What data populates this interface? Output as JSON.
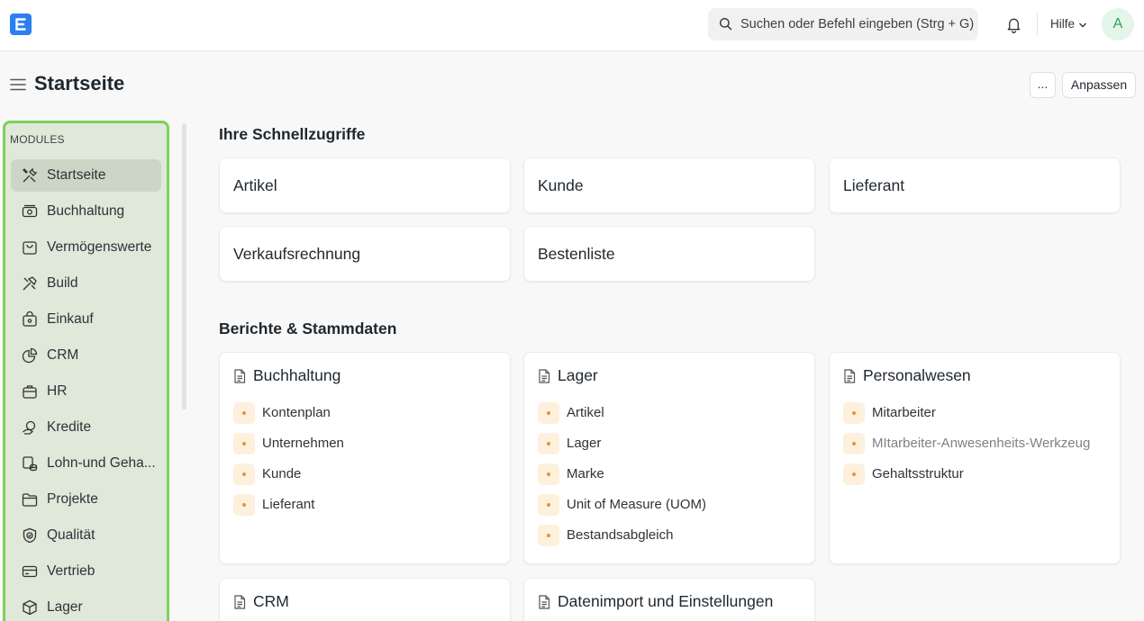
{
  "navbar": {
    "search_placeholder": "Suchen oder Befehl eingeben (Strg + G)",
    "help_label": "Hilfe",
    "avatar_initial": "A"
  },
  "page": {
    "title": "Startseite",
    "more_label": "...",
    "customize_label": "Anpassen"
  },
  "sidebar": {
    "title": "MODULES",
    "items": [
      {
        "label": "Startseite",
        "icon": "tools-icon",
        "active": true
      },
      {
        "label": "Buchhaltung",
        "icon": "money-icon"
      },
      {
        "label": "Vermögenswerte",
        "icon": "bag-icon"
      },
      {
        "label": "Build",
        "icon": "hammer-icon"
      },
      {
        "label": "Einkauf",
        "icon": "shopping-bag-icon"
      },
      {
        "label": "CRM",
        "icon": "pie-chart-icon"
      },
      {
        "label": "HR",
        "icon": "briefcase-icon"
      },
      {
        "label": "Kredite",
        "icon": "hand-coins-icon"
      },
      {
        "label": "Lohn-und Geha...",
        "icon": "payroll-icon"
      },
      {
        "label": "Projekte",
        "icon": "folder-icon"
      },
      {
        "label": "Qualität",
        "icon": "shield-check-icon"
      },
      {
        "label": "Vertrieb",
        "icon": "card-icon"
      },
      {
        "label": "Lager",
        "icon": "box-icon"
      }
    ]
  },
  "shortcuts": {
    "title": "Ihre Schnellzugriffe",
    "items": [
      "Artikel",
      "Kunde",
      "Lieferant",
      "Verkaufsrechnung",
      "Bestenliste"
    ]
  },
  "reports": {
    "title": "Berichte & Stammdaten",
    "cards": [
      {
        "title": "Buchhaltung",
        "links": [
          "Kontenplan",
          "Unternehmen",
          "Kunde",
          "Lieferant"
        ]
      },
      {
        "title": "Lager",
        "links": [
          "Artikel",
          "Lager",
          "Marke",
          "Unit of Measure (UOM)",
          "Bestandsabgleich"
        ]
      },
      {
        "title": "Personalwesen",
        "links": [
          "Mitarbeiter",
          "MItarbeiter-Anwesenheits-Werkzeug",
          "Gehaltsstruktur"
        ]
      },
      {
        "title": "CRM",
        "links": []
      },
      {
        "title": "Datenimport und Einstellungen",
        "links": []
      }
    ]
  },
  "colors": {
    "accent": "#2b7ff0",
    "sidebar_highlight_border": "#7ed15a",
    "link_dot": "#e8913a"
  }
}
